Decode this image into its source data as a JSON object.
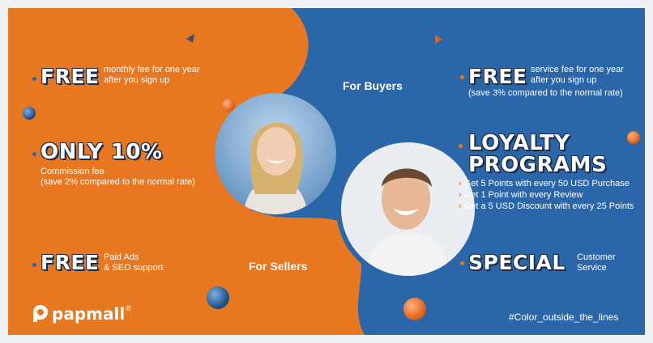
{
  "brand": {
    "name": "papmall",
    "registered": "®",
    "colors": {
      "orange": "#e87722",
      "blue": "#2a66a8"
    }
  },
  "sellers": {
    "label": "For Sellers",
    "offer1": {
      "headline": "FREE",
      "line1": "monthly fee for one year",
      "line2": "after you sign up"
    },
    "offer2": {
      "headline": "ONLY 10%",
      "line1": "Commission fee",
      "line2": "(save 2% compared to the normal rate)"
    },
    "offer3": {
      "headline": "FREE",
      "line1": "Paid Ads",
      "line2": "& SEO support"
    }
  },
  "buyers": {
    "label": "For Buyers",
    "offer1": {
      "headline": "FREE",
      "line1": "service fee for one year",
      "line2": "after you sign up",
      "line3": "(save 3% compared to the normal rate)"
    },
    "offer2": {
      "headline_line1": "LOYALTY",
      "headline_line2": "PROGRAMS",
      "items": [
        "Get 5 Points with every 50 USD Purchase",
        "Get 1 Point with every Review",
        "Get a 5 USD Discount with every 25 Points"
      ]
    },
    "offer3": {
      "headline": "SPECIAL",
      "line1": "Customer",
      "line2": "Service"
    }
  },
  "hashtag": "#Color_outside_the_lines"
}
